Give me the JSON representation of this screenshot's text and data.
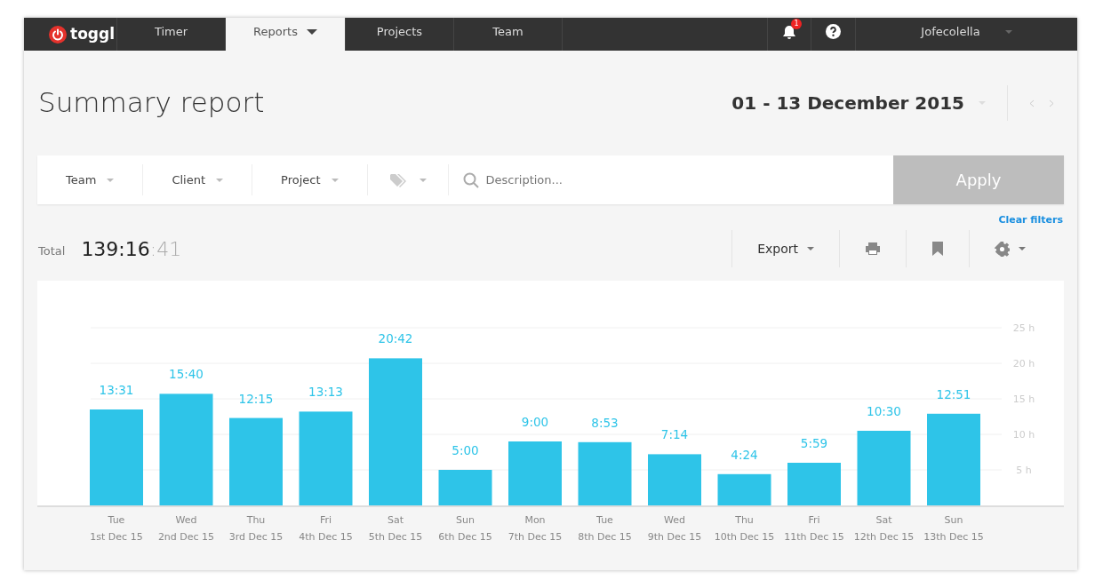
{
  "navbar": {
    "logo": "toggl",
    "tabs": [
      {
        "label": "Timer",
        "selected": false,
        "dropdown": false
      },
      {
        "label": "Reports",
        "selected": true,
        "dropdown": true
      },
      {
        "label": "Projects",
        "selected": false,
        "dropdown": false
      },
      {
        "label": "Team",
        "selected": false,
        "dropdown": false
      }
    ],
    "notification_count": "1",
    "user": "Jofecolella"
  },
  "header": {
    "title": "Summary report",
    "date_range": "01 - 13 December 2015"
  },
  "filters": {
    "items": [
      "Team",
      "Client",
      "Project"
    ],
    "search_placeholder": "Description...",
    "apply": "Apply",
    "clear": "Clear filters"
  },
  "totals": {
    "label": "Total",
    "value": "139:16",
    "seconds": ":41",
    "export": "Export"
  },
  "chart": {
    "chart_data": {
      "type": "bar",
      "categories": [
        "Tue 1st Dec 15",
        "Wed 2nd Dec 15",
        "Thu 3rd Dec 15",
        "Fri 4th Dec 15",
        "Sat 5th Dec 15",
        "Sun 6th Dec 15",
        "Mon 7th Dec 15",
        "Tue 8th Dec 15",
        "Wed 9th Dec 15",
        "Thu 10th Dec 15",
        "Fri 11th Dec 15",
        "Sat 12th Dec 15",
        "Sun 13th Dec 15"
      ],
      "series": [
        {
          "color": "#2ec4e8",
          "values": [
            13.5,
            15.7,
            12.3,
            13.2,
            20.7,
            5,
            9,
            8.9,
            7.2,
            4.4,
            6,
            10.5,
            12.9
          ]
        }
      ],
      "grid": true,
      "value_labels": [
        "13:31",
        "15:40",
        "12:15",
        "13:13",
        "20:42",
        "5:00",
        "9:00",
        "8:53",
        "7:14",
        "4:24",
        "5:59",
        "10:30",
        "12:51"
      ],
      "ylim": [
        0,
        25
      ],
      "yticks": [
        {
          "value": 5,
          "label": "5 h"
        },
        {
          "value": 10,
          "label": "10 h"
        },
        {
          "value": 15,
          "label": "15 h"
        },
        {
          "value": 20,
          "label": "20 h"
        },
        {
          "value": 25,
          "label": "25 h"
        }
      ]
    }
  }
}
